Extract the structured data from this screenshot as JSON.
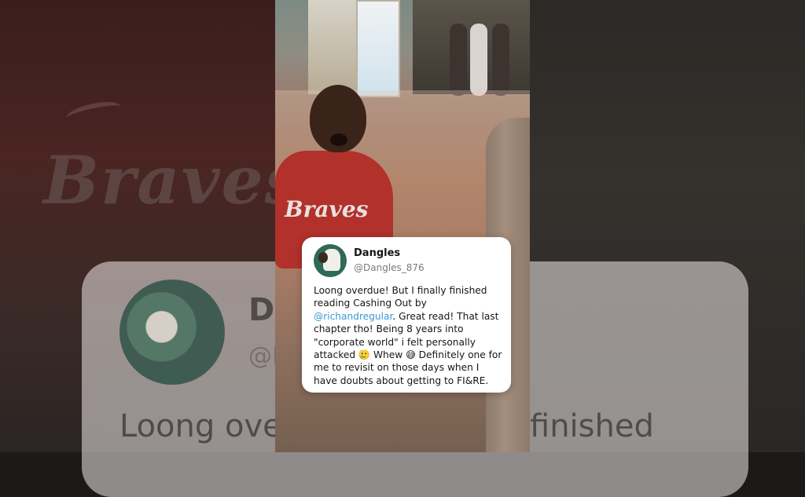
{
  "tweet": {
    "display_name": "Dangles",
    "handle": "@Dangles_876",
    "text_before_mention": "Loong overdue! But I finally finished reading Cashing Out by ",
    "mention": "@richandregular",
    "text_after_mention": ". Great read! That last chapter tho! Being 8 years into \"corporate world\" i felt personally attacked 🥲 Whew 😅 Definitely one for me to revisit on those days when I have doubts about getting to FI&RE.",
    "mention_color": "#3a98d6"
  },
  "background": {
    "shirt_text": "Braves",
    "card_name_fragment": "Da",
    "card_handle_fragment": "@D",
    "card_body_left": "Loong over",
    "card_body_right": "finished"
  },
  "photo": {
    "shirt_text": "Braves"
  }
}
